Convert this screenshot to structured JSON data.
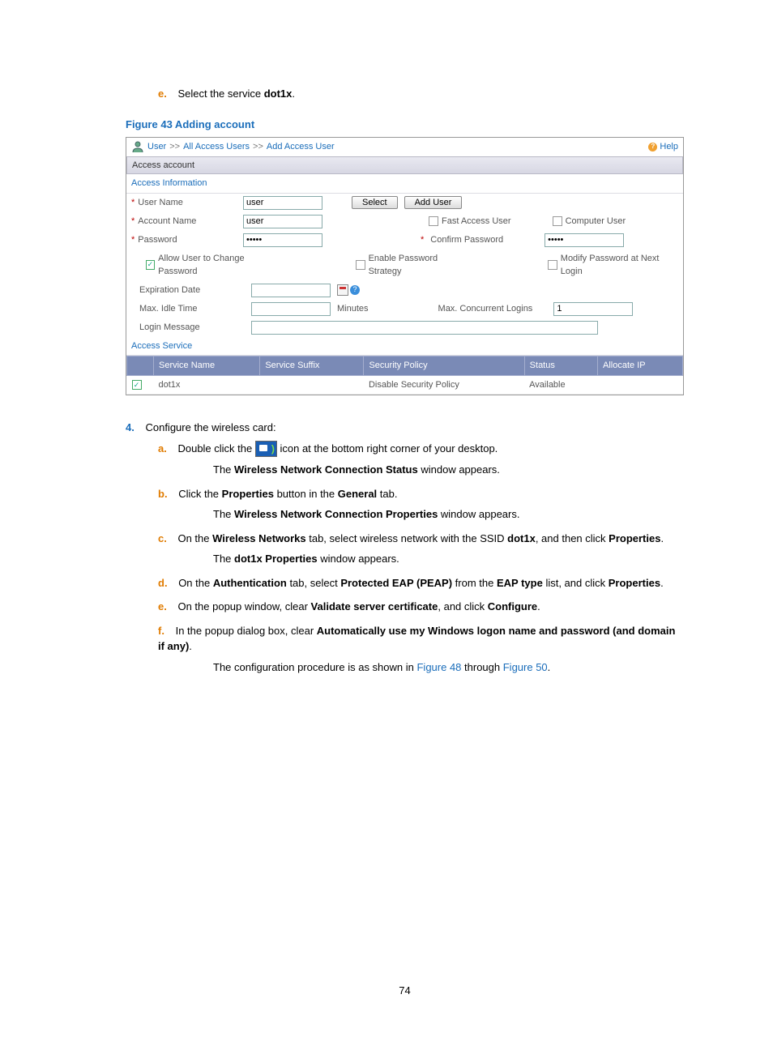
{
  "intro": {
    "e_letter": "e.",
    "e_text_pre": "Select the service ",
    "e_bold": "dot1x",
    "e_text_post": "."
  },
  "figure_caption": "Figure 43 Adding account",
  "ui": {
    "breadcrumb": {
      "a": "User",
      "b": "All Access Users",
      "c": "Add Access User",
      "sep": ">>"
    },
    "help": "Help",
    "access_account": "Access account",
    "access_info": "Access Information",
    "row_user": {
      "label": "User Name",
      "value": "user",
      "btn_select": "Select",
      "btn_add": "Add User"
    },
    "row_account": {
      "label": "Account Name",
      "value": "user",
      "fast": "Fast Access User",
      "computer": "Computer User"
    },
    "row_pw": {
      "label": "Password",
      "value": "•••••",
      "confirm_label": "Confirm Password",
      "confirm_value": "•••••"
    },
    "row_opts": {
      "allow": "Allow User to Change Password",
      "strategy": "Enable Password Strategy",
      "next": "Modify Password at Next Login"
    },
    "row_exp": {
      "label": "Expiration Date"
    },
    "row_idle": {
      "label": "Max. Idle Time",
      "unit": "Minutes",
      "concurrent": "Max. Concurrent Logins",
      "concurrent_value": "1"
    },
    "row_msg": {
      "label": "Login Message"
    },
    "access_service": "Access Service",
    "table": {
      "h1": "Service Name",
      "h2": "Service Suffix",
      "h3": "Security Policy",
      "h4": "Status",
      "h5": "Allocate IP",
      "r1": {
        "name": "dot1x",
        "policy": "Disable Security Policy",
        "status": "Available"
      }
    }
  },
  "step4": {
    "num": "4.",
    "title": "Configure the wireless card:",
    "a": {
      "l": "a.",
      "pre": "Double click the ",
      "post": " icon at the bottom right corner of your desktop.",
      "after": "The ",
      "bold": "Wireless Network Connection Status",
      "after2": " window appears."
    },
    "b": {
      "l": "b.",
      "pre": "Click the ",
      "b1": "Properties",
      "mid": " button in the ",
      "b2": "General",
      "post": " tab.",
      "after": "The ",
      "bold": "Wireless Network Connection Properties",
      "after2": " window appears."
    },
    "c": {
      "l": "c.",
      "pre": "On the ",
      "b1": "Wireless Networks",
      "mid": " tab, select wireless network with the SSID ",
      "b2": "dot1x",
      "post": ", and then click ",
      "b3": "Properties",
      "dot": ".",
      "after": "The ",
      "bold": "dot1x Properties",
      "after2": " window appears."
    },
    "d": {
      "l": "d.",
      "pre": "On the ",
      "b1": "Authentication",
      "mid": " tab, select ",
      "b2": "Protected EAP (PEAP)",
      "mid2": " from the ",
      "b3": "EAP type",
      "post": " list, and click ",
      "b4": "Properties",
      "dot": "."
    },
    "e": {
      "l": "e.",
      "pre": "On the popup window, clear ",
      "b1": "Validate server certificate",
      "mid": ", and click ",
      "b2": "Configure",
      "dot": "."
    },
    "f": {
      "l": "f.",
      "pre": "In the popup dialog box, clear ",
      "b1": "Automatically use my Windows logon name and password (and domain if any)",
      "dot": ".",
      "after": "The configuration procedure is as shown in ",
      "f1": "Figure 48",
      "mid": " through ",
      "f2": "Figure 50",
      "dot2": "."
    }
  },
  "page_no": "74"
}
